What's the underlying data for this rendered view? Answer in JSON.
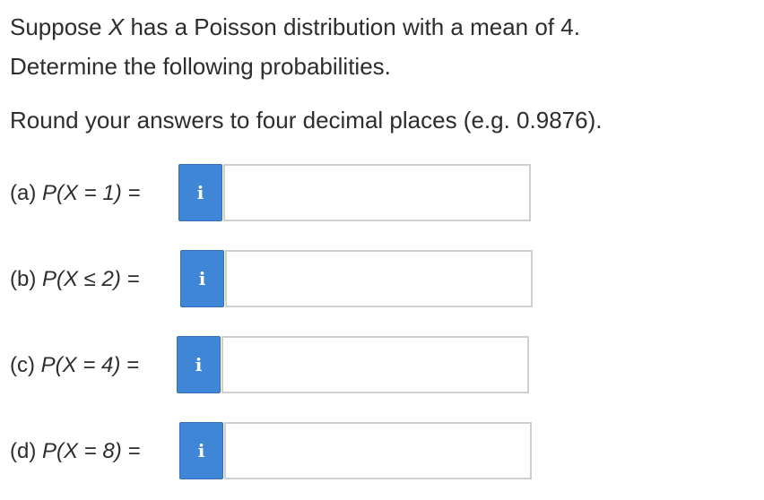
{
  "question": {
    "stem_line1_pre": "Suppose ",
    "stem_var": "X",
    "stem_line1_post": " has a Poisson distribution with a mean of 4.",
    "stem_line2": "Determine the following probabilities.",
    "rounding": "Round your answers to four decimal places (e.g. 0.9876)."
  },
  "parts": [
    {
      "prefix": "(a) ",
      "expr": "P(X = 1) =",
      "answer": ""
    },
    {
      "prefix": "(b) ",
      "expr": "P(X ≤ 2) =",
      "answer": ""
    },
    {
      "prefix": "(c) ",
      "expr": "P(X = 4) =",
      "answer": ""
    },
    {
      "prefix": "(d) ",
      "expr": "P(X = 8) =",
      "answer": ""
    }
  ],
  "info_icon": {
    "glyph": "i",
    "icon": "info-icon",
    "color": "#3f86d6"
  }
}
